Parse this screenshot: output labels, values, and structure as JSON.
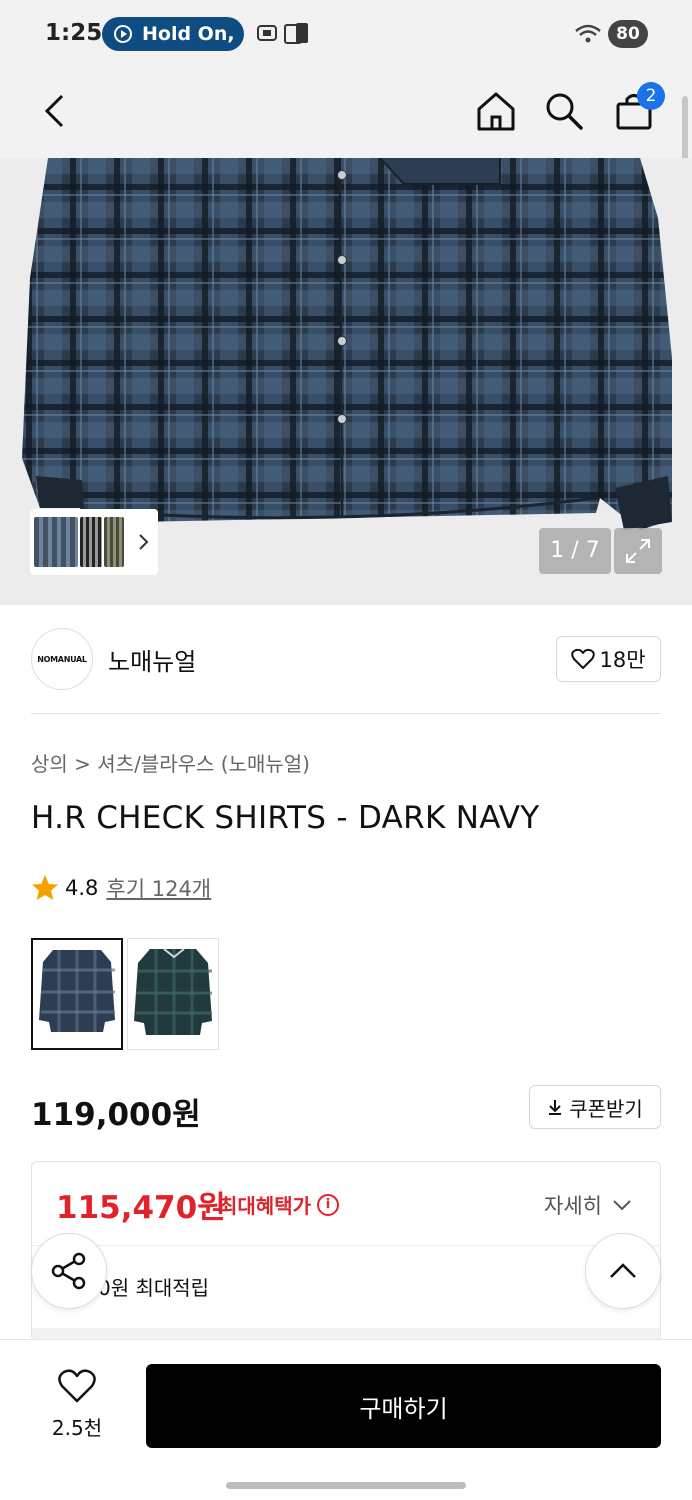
{
  "status_bar": {
    "time": "1:25",
    "notification": "Hold On,",
    "battery": "80"
  },
  "header": {
    "cart_count": "2"
  },
  "gallery": {
    "counter": "1 / 7"
  },
  "brand": {
    "logo_text": "NOMANUAL",
    "name": "노매뉴얼",
    "likes": "18만"
  },
  "product": {
    "breadcrumb": "상의 > 셔츠/블라우스 (노매뉴얼)",
    "title": "H.R CHECK SHIRTS - DARK NAVY",
    "rating": "4.8",
    "reviews": "후기 124개",
    "price": "119,000원",
    "coupon_label": "쿠폰받기"
  },
  "benefit": {
    "price": "115,470원",
    "label": "최대혜택가",
    "detail_label": "자세히",
    "points": "0원 최대적립"
  },
  "bottom": {
    "wish_count": "2.5천",
    "buy_label": "구매하기"
  },
  "colors": {
    "accent_red": "#e0232b",
    "badge_blue": "#1a73e8",
    "buy_black": "#000000"
  }
}
